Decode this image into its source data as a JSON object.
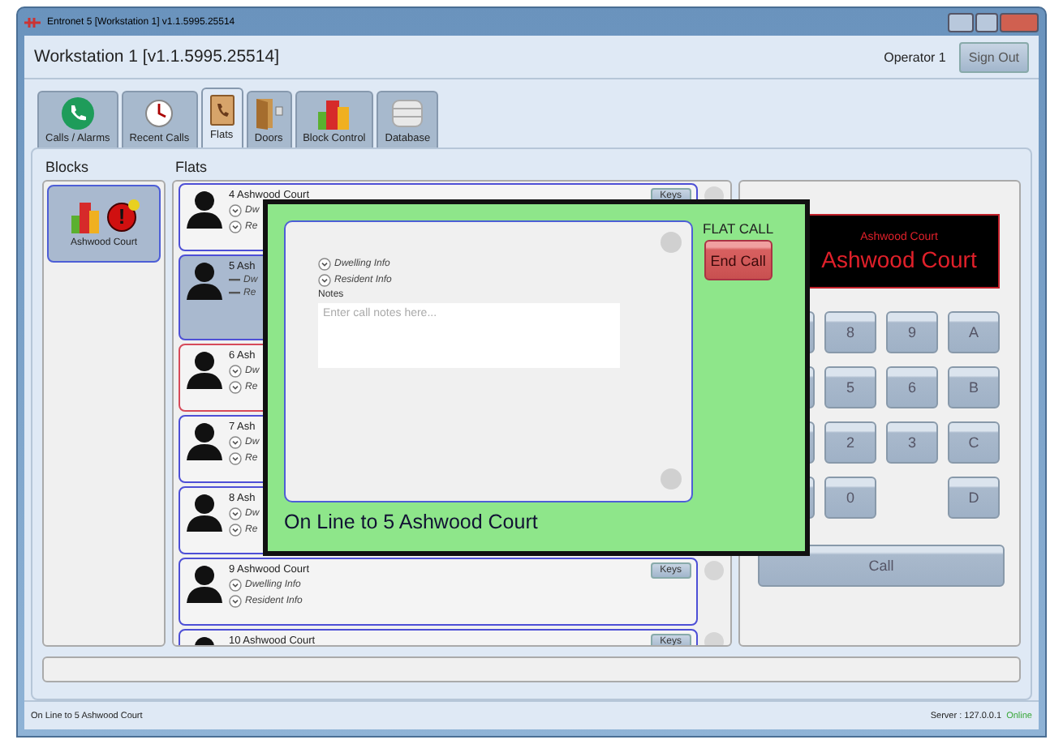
{
  "window": {
    "title": "Entronet 5 [Workstation 1] v1.1.5995.25514"
  },
  "header": {
    "title": "Workstation 1 [v1.1.5995.25514]",
    "operator": "Operator 1",
    "sign_out": "Sign Out"
  },
  "tabs": [
    {
      "label": "Calls / Alarms",
      "selected": false
    },
    {
      "label": "Recent Calls",
      "selected": false
    },
    {
      "label": "Flats",
      "selected": true
    },
    {
      "label": "Doors",
      "selected": false
    },
    {
      "label": "Block Control",
      "selected": false
    },
    {
      "label": "Database",
      "selected": false
    }
  ],
  "blocks": {
    "label": "Blocks",
    "items": [
      {
        "name": "Ashwood Court",
        "selected": true,
        "badge": "!"
      }
    ]
  },
  "flats": {
    "label": "Flats",
    "items": [
      {
        "name": "4 Ashwood Court",
        "dwelling": "Dw",
        "resident": "Re",
        "keys": "Keys",
        "selected": false,
        "alert": false,
        "expanded": false
      },
      {
        "name": "5 Ash",
        "dwelling": "Dw",
        "resident": "Re",
        "selected": true,
        "alert": false,
        "expanded": true
      },
      {
        "name": "6 Ash",
        "dwelling": "Dw",
        "resident": "Re",
        "selected": false,
        "alert": true,
        "expanded": false
      },
      {
        "name": "7 Ash",
        "dwelling": "Dw",
        "resident": "Re",
        "selected": false,
        "alert": false,
        "expanded": false
      },
      {
        "name": "8 Ash",
        "dwelling": "Dw",
        "resident": "Re",
        "selected": false,
        "alert": false,
        "expanded": false
      },
      {
        "name": "9 Ashwood Court",
        "dwelling": "Dwelling Info",
        "resident": "Resident Info",
        "keys": "Keys",
        "selected": false,
        "alert": false,
        "expanded": false
      },
      {
        "name": "10 Ashwood Court",
        "keys": "Keys",
        "selected": false,
        "alert": false,
        "expanded": false
      }
    ]
  },
  "display": {
    "small": "Ashwood Court",
    "large": "Ashwood Court"
  },
  "keypad": [
    [
      "8",
      "9",
      "A"
    ],
    [
      "5",
      "6",
      "B"
    ],
    [
      "2",
      "3",
      "C"
    ],
    [
      "0",
      "D"
    ]
  ],
  "call_button": "Call",
  "dialog": {
    "title": "FLAT CALL",
    "end_call": "End Call",
    "dwelling": "Dwelling Info",
    "resident": "Resident Info",
    "notes_label": "Notes",
    "notes_placeholder": "Enter call notes here...",
    "status": "On Line to 5 Ashwood Court"
  },
  "status_bar": {
    "message": "On Line to 5 Ashwood Court",
    "server": "Server : 127.0.0.1",
    "connection": "Online"
  }
}
